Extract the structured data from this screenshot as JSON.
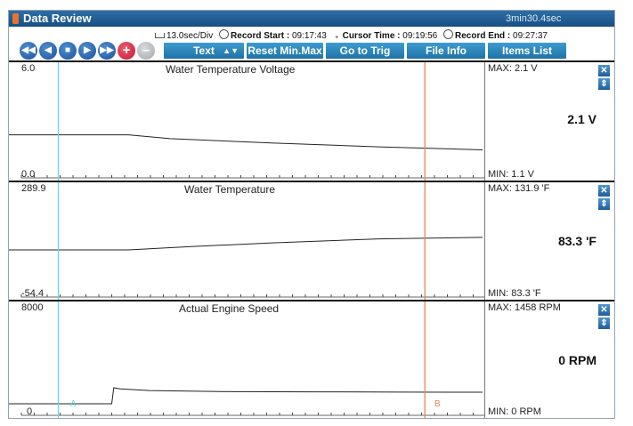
{
  "window": {
    "title": "Data Review",
    "duration": "3min30.4sec"
  },
  "info": {
    "scale": "13.0sec/Div",
    "record_start_label": "Record Start :",
    "record_start_value": "09:17:43",
    "cursor_time_label": "Cursor Time :",
    "cursor_time_value": "09:19:56",
    "record_end_label": "Record End :",
    "record_end_value": "09:27:37"
  },
  "toolbar": {
    "text_select": "Text",
    "reset_label": "Reset Min.Max",
    "trig_label": "Go to Trig",
    "fileinfo_label": "File Info",
    "items_label": "Items List"
  },
  "colors": {
    "cursor_a": "#62d8e8",
    "cursor_b": "#e08a5a",
    "plot_line": "#222222",
    "accent": "#1f73a8"
  },
  "cursors": {
    "a_label": "A",
    "b_label": "B",
    "a_fraction": 0.104,
    "b_fraction": 0.875
  },
  "panels": [
    {
      "title": "Water Temperature Voltage",
      "ymax": "6.0",
      "ymin": "0.0",
      "max_text": "MAX:   2.1 V",
      "min_text": "MIN:   1.1 V",
      "current": "2.1 V"
    },
    {
      "title": "Water Temperature",
      "ymax": "289.9",
      "ymin": "-54.4",
      "max_text": "MAX: 131.9 'F",
      "min_text": "MIN:  83.3 'F",
      "current": "83.3 'F"
    },
    {
      "title": "Actual Engine Speed",
      "ymax": "8000",
      "ymin": "0",
      "max_text": "MAX:  1458 RPM",
      "min_text": "MIN:     0 RPM",
      "current": "0 RPM"
    }
  ],
  "chart_data": [
    {
      "type": "line",
      "title": "Water Temperature Voltage",
      "ylim": [
        0.0,
        6.0
      ],
      "x": [
        0,
        0.15,
        0.25,
        0.5,
        0.75,
        1.0
      ],
      "y": [
        2.1,
        2.1,
        1.85,
        1.55,
        1.3,
        1.1
      ]
    },
    {
      "type": "line",
      "title": "Water Temperature",
      "ylim": [
        -54.4,
        289.9
      ],
      "x": [
        0,
        0.15,
        0.3,
        0.5,
        0.75,
        1.0
      ],
      "y": [
        83.3,
        83.3,
        96,
        111,
        126,
        131.9
      ]
    },
    {
      "type": "line",
      "title": "Actual Engine Speed",
      "ylim": [
        0,
        8000
      ],
      "x": [
        0,
        0.11,
        0.115,
        0.13,
        0.2,
        0.4,
        0.6,
        0.8,
        1.0
      ],
      "y": [
        0,
        0,
        1458,
        1350,
        1200,
        1100,
        1080,
        1060,
        1050
      ]
    }
  ]
}
